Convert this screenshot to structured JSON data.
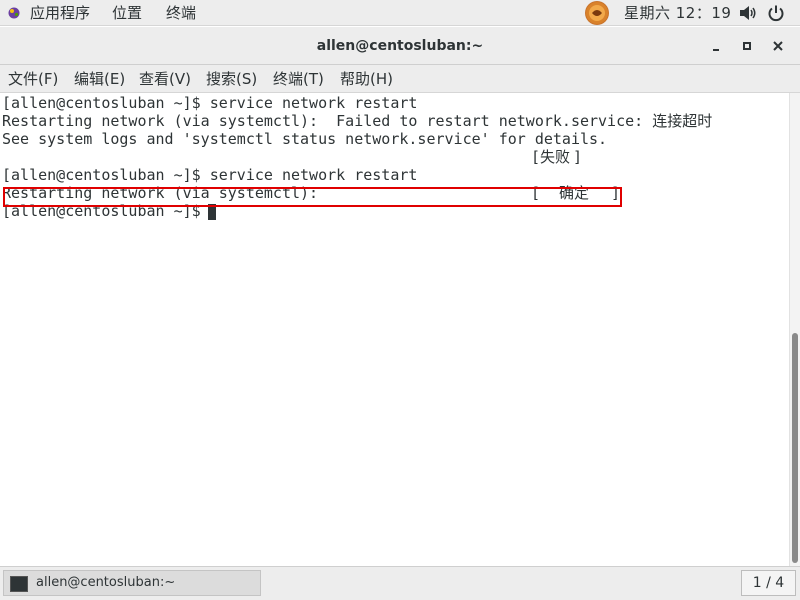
{
  "top_panel": {
    "applications": "应用程序",
    "places": "位置",
    "terminal": "终端",
    "clock": "星期六 12：19",
    "icons": {
      "applications": "apps-icon",
      "tray": "tray-avatar-icon",
      "volume": "volume-icon",
      "power": "power-icon"
    }
  },
  "window": {
    "title": "allen@centosluban:~"
  },
  "menubar": {
    "file": "文件(F)",
    "edit": "编辑(E)",
    "view": "查看(V)",
    "search": "搜索(S)",
    "terminal": "终端(T)",
    "help": "帮助(H)"
  },
  "terminal": {
    "line1": "[allen@centosluban ~]$ service network restart",
    "line2": "Restarting network (via systemctl):  Failed to restart network.service: 连接超时",
    "line3": "See system logs and 'systemctl status network.service' for details.",
    "line4_status": "失败",
    "line5": "[allen@centosluban ~]$ service network restart",
    "line6": "Restarting network (via systemctl):",
    "line6_status": "确定",
    "line7": "[allen@centosluban ~]$ "
  },
  "bottom_panel": {
    "task_label": "allen@centosluban:~",
    "workspace": "1 / 4"
  },
  "colors": {
    "failed": "#cc0000",
    "ok": "#4e9a06",
    "highlight": "#e00000"
  }
}
